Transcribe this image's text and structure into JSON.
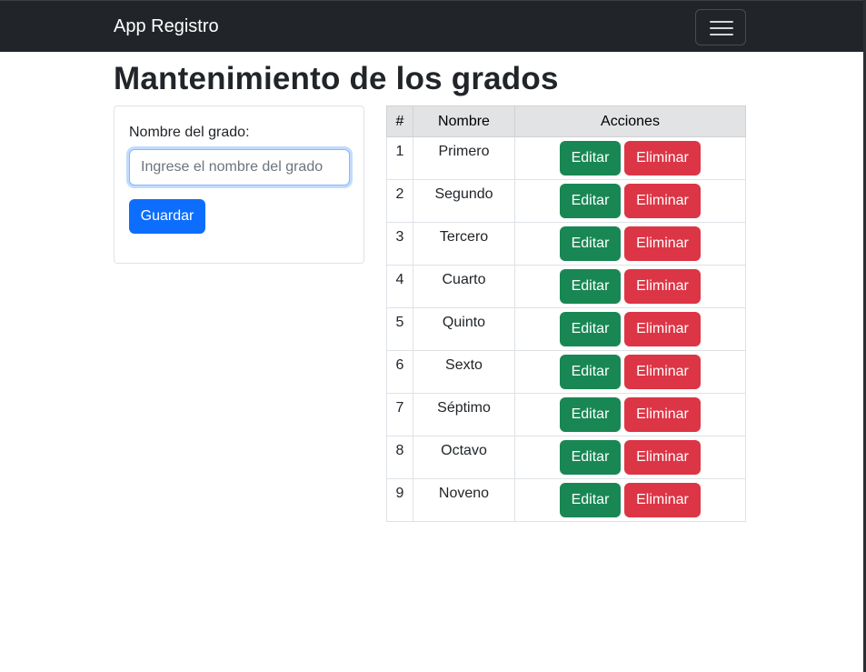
{
  "navbar": {
    "brand": "App Registro",
    "toggler_icon": "hamburger-icon"
  },
  "page": {
    "title": "Mantenimiento de los grados"
  },
  "form": {
    "label": "Nombre del grado:",
    "input_value": "",
    "input_placeholder": "Ingrese el nombre del grado",
    "save_label": "Guardar"
  },
  "table": {
    "headers": [
      "#",
      "Nombre",
      "Acciones"
    ],
    "rows": [
      {
        "id": "1",
        "name": "Primero"
      },
      {
        "id": "2",
        "name": "Segundo"
      },
      {
        "id": "3",
        "name": "Tercero"
      },
      {
        "id": "4",
        "name": "Cuarto"
      },
      {
        "id": "5",
        "name": "Quinto"
      },
      {
        "id": "6",
        "name": "Sexto"
      },
      {
        "id": "7",
        "name": "Séptimo"
      },
      {
        "id": "8",
        "name": "Octavo"
      },
      {
        "id": "9",
        "name": "Noveno"
      }
    ],
    "edit_label": "Editar",
    "delete_label": "Eliminar"
  },
  "colors": {
    "navbar": "#212529",
    "primary": "#0d6efd",
    "success": "#198754",
    "danger": "#dc3545"
  }
}
